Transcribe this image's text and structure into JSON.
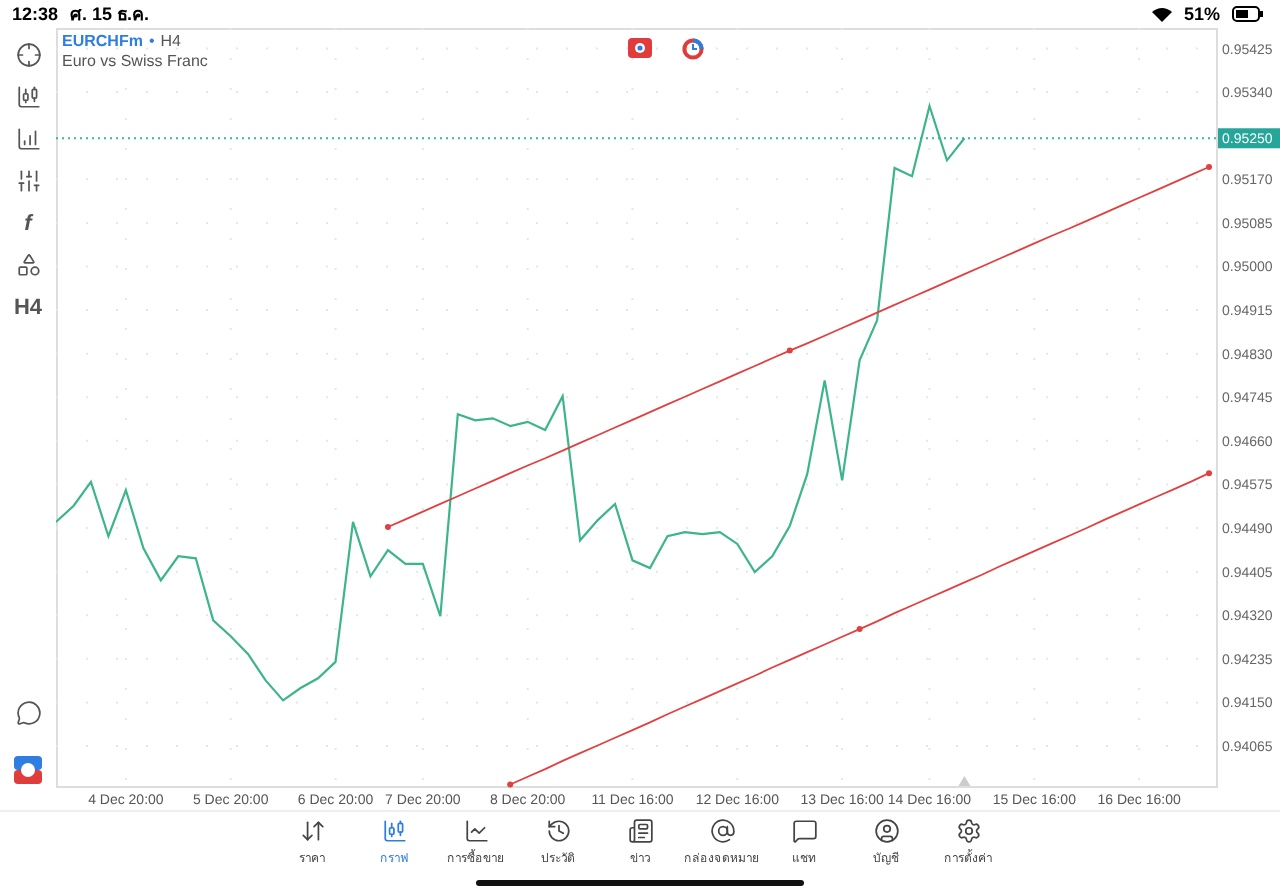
{
  "status_bar": {
    "time": "12:38",
    "date": "ศ. 15 ธ.ค.",
    "battery": "51%"
  },
  "toolbar": [
    {
      "kind": "crosshair"
    },
    {
      "kind": "candles"
    },
    {
      "kind": "indicators"
    },
    {
      "kind": "sliders"
    },
    {
      "kind": "text",
      "label": "f"
    },
    {
      "kind": "objects"
    },
    {
      "kind": "text",
      "label": "H4"
    }
  ],
  "toolbar_bottom": [
    {
      "kind": "alert"
    },
    {
      "kind": "logo"
    }
  ],
  "chart_header": {
    "separator": "•",
    "timeframe": "H4",
    "description": "Euro vs Swiss Franc"
  },
  "chart": {
    "chart_data": {
      "type": "line",
      "grid": true,
      "ylim": [
        0.93987,
        0.95465
      ],
      "categories": [
        null,
        null,
        null,
        null,
        "4 Dec 20:00",
        null,
        null,
        null,
        null,
        null,
        "5 Dec 20:00",
        null,
        null,
        null,
        null,
        null,
        "6 Dec 20:00",
        null,
        null,
        null,
        null,
        "7 Dec 20:00",
        null,
        null,
        null,
        null,
        null,
        "8 Dec 20:00",
        null,
        null,
        null,
        null,
        null,
        "11 Dec 16:00",
        null,
        null,
        null,
        null,
        null,
        "12 Dec 16:00",
        null,
        null,
        null,
        null,
        null,
        "13 Dec 16:00",
        null,
        null,
        null,
        null,
        "14 Dec 16:00",
        null,
        null,
        null,
        null,
        null,
        "15 Dec 16:00",
        null,
        null,
        null,
        null,
        null,
        "16 Dec 16:00",
        null,
        null,
        null,
        null
      ],
      "yticks": [
        {
          "value": 0.95425,
          "label": "0.95425"
        },
        {
          "value": 0.9534,
          "label": "0.95340"
        },
        {
          "value": 0.9517,
          "label": "0.95170"
        },
        {
          "value": 0.95085,
          "label": "0.95085"
        },
        {
          "value": 0.95,
          "label": "0.95000"
        },
        {
          "value": 0.94915,
          "label": "0.94915"
        },
        {
          "value": 0.9483,
          "label": "0.94830"
        },
        {
          "value": 0.94745,
          "label": "0.94745"
        },
        {
          "value": 0.9466,
          "label": "0.94660"
        },
        {
          "value": 0.94575,
          "label": "0.94575"
        },
        {
          "value": 0.9449,
          "label": "0.94490"
        },
        {
          "value": 0.94405,
          "label": "0.94405"
        },
        {
          "value": 0.9432,
          "label": "0.94320"
        },
        {
          "value": 0.94235,
          "label": "0.94235"
        },
        {
          "value": 0.9415,
          "label": "0.94150"
        },
        {
          "value": 0.94065,
          "label": "0.94065"
        }
      ],
      "series": [
        {
          "name": "EURCHFm",
          "color": "#3cb48c",
          "values": [
            0.94502,
            0.94533,
            0.9458,
            0.94474,
            0.94564,
            0.94451,
            0.94388,
            0.94435,
            0.94431,
            0.9431,
            0.94279,
            0.94244,
            0.94193,
            0.94154,
            0.94178,
            0.94197,
            0.94229,
            0.94502,
            0.94396,
            0.94447,
            0.9442,
            0.9442,
            0.94318,
            0.94712,
            0.947,
            0.94704,
            0.94689,
            0.94697,
            0.94681,
            0.94747,
            0.94466,
            0.94505,
            0.94537,
            0.94427,
            0.94412,
            0.94474,
            0.94482,
            0.94478,
            0.94482,
            0.94459,
            0.94404,
            0.94435,
            0.94494,
            0.94595,
            0.94778,
            0.94583,
            0.94817,
            0.94895,
            0.95192,
            0.95176,
            0.95313,
            0.95207,
            0.9525,
            null,
            null,
            null,
            null,
            null,
            null,
            null,
            null,
            null,
            null,
            null,
            null,
            null,
            null
          ]
        },
        {
          "color": "#e04040",
          "values": [
            null,
            null,
            null,
            null,
            null,
            null,
            null,
            null,
            null,
            null,
            null,
            null,
            null,
            null,
            null,
            null,
            null,
            null,
            null,
            0.94492,
            0.94507,
            0.94522,
            0.94537,
            0.94552,
            0.94567,
            0.94582,
            0.94597,
            0.94612,
            0.94626,
            0.94641,
            0.94656,
            0.94671,
            0.94686,
            0.94701,
            0.94716,
            0.94731,
            0.94746,
            0.94761,
            0.94776,
            0.94791,
            0.94806,
            0.94821,
            0.94836,
            0.9485,
            0.94865,
            0.9488,
            0.94895,
            0.9491,
            0.94925,
            0.9494,
            0.94955,
            0.9497,
            0.94985,
            0.95,
            0.95015,
            0.9503,
            0.95045,
            0.9506,
            0.95074,
            0.95089,
            0.95104,
            0.95119,
            0.95134,
            0.95149,
            0.95164,
            0.95179,
            0.95194
          ]
        },
        {
          "color": "#e04040",
          "values": [
            null,
            null,
            null,
            null,
            null,
            null,
            null,
            null,
            null,
            null,
            null,
            null,
            null,
            null,
            null,
            null,
            null,
            null,
            null,
            null,
            null,
            null,
            null,
            null,
            null,
            null,
            0.9399,
            0.94005,
            0.9402,
            0.94036,
            0.94051,
            0.94066,
            0.94081,
            0.94096,
            0.94111,
            0.94127,
            0.94142,
            0.94157,
            0.94172,
            0.94187,
            0.94202,
            0.94218,
            0.94233,
            0.94248,
            0.94263,
            0.94278,
            0.94293,
            0.94308,
            0.94324,
            0.94339,
            0.94354,
            0.94369,
            0.94384,
            0.94399,
            0.94415,
            0.9443,
            0.94445,
            0.9446,
            0.94475,
            0.9449,
            0.94506,
            0.94521,
            0.94536,
            0.94551,
            0.94566,
            0.94581,
            0.94597
          ]
        }
      ],
      "ref_lines": [
        {
          "axis": "y",
          "value": 0.9525,
          "label": "0.95250"
        }
      ]
    }
  },
  "tabs": [
    {
      "kind": "quotes",
      "label": "ราคา",
      "selected": false
    },
    {
      "kind": "chart",
      "label": "กราฟ",
      "selected": true
    },
    {
      "kind": "trade",
      "label": "การซื้อขาย",
      "selected": false
    },
    {
      "kind": "history",
      "label": "ประวัติ",
      "selected": false
    },
    {
      "kind": "news",
      "label": "ข่าว",
      "selected": false
    },
    {
      "kind": "mail",
      "label": "กล่องจดหมาย",
      "selected": false
    },
    {
      "kind": "chat",
      "label": "แชท",
      "selected": false
    },
    {
      "kind": "account",
      "label": "บัญชี",
      "selected": false
    },
    {
      "kind": "settings",
      "label": "การตั้งค่า",
      "selected": false
    }
  ]
}
